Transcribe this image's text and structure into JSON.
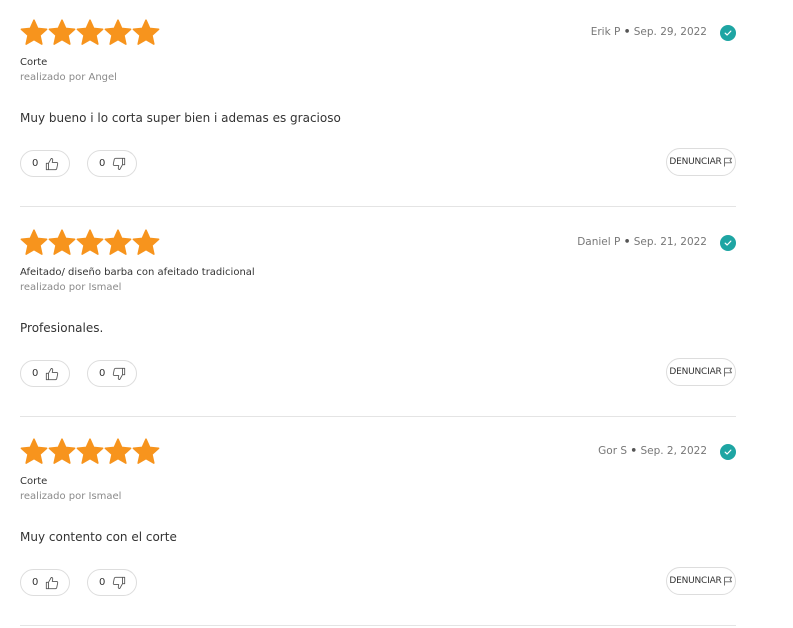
{
  "colors": {
    "star": "#F7941D",
    "verified": "#1EA5A3",
    "divider": "#E4E4E4"
  },
  "reviews": [
    {
      "rating": 5,
      "author": "Erik P",
      "separator": "•",
      "date": "Sep. 29, 2022",
      "service": "Corte",
      "performer": "realizado por Angel",
      "text": "Muy bueno i lo corta super bien i ademas es gracioso",
      "likes": "0",
      "dislikes": "0",
      "report_label": "DENUNCIAR"
    },
    {
      "rating": 5,
      "author": "Daniel P",
      "separator": "•",
      "date": "Sep. 21, 2022",
      "service": "Afeitado/ diseño barba con afeitado tradicional",
      "performer": "realizado por Ismael",
      "text": "Profesionales.",
      "likes": "0",
      "dislikes": "0",
      "report_label": "DENUNCIAR"
    },
    {
      "rating": 5,
      "author": "Gor S",
      "separator": "•",
      "date": "Sep. 2, 2022",
      "service": "Corte",
      "performer": "realizado por Ismael",
      "text": "Muy contento con el corte",
      "likes": "0",
      "dislikes": "0",
      "report_label": "DENUNCIAR"
    }
  ],
  "icons": {
    "star": "star-icon",
    "verified": "checkmark-icon",
    "like": "thumbs-up-icon",
    "dislike": "thumbs-down-icon",
    "report": "flag-icon"
  }
}
